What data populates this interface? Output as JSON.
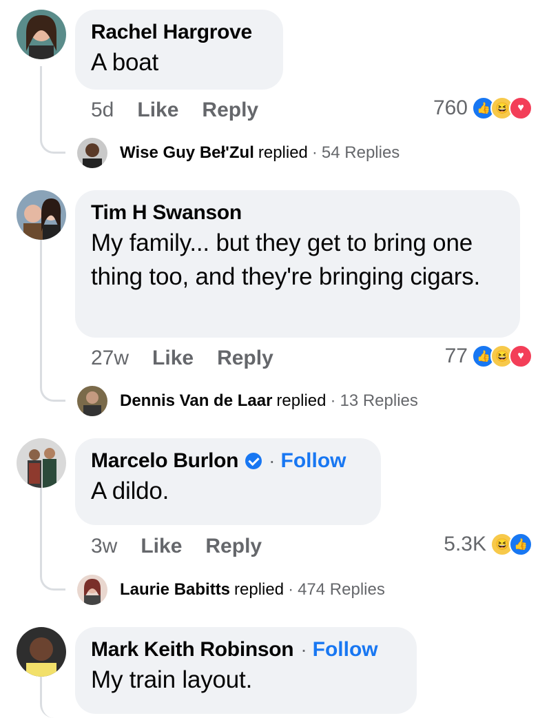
{
  "comments": [
    {
      "author": "Rachel Hargrove",
      "text": "A boat",
      "time": "5d",
      "like": "Like",
      "reply": "Reply",
      "reaction_count": "760",
      "reactions": [
        "like",
        "haha",
        "love"
      ],
      "reply_preview": {
        "name": "Wise Guy Beł'Zul",
        "action": "replied",
        "dot": "·",
        "count": "54 Replies"
      }
    },
    {
      "author": "Tim H Swanson",
      "text": "My family... but they get to bring one thing too, and they're bringing cigars.",
      "time": "27w",
      "like": "Like",
      "reply": "Reply",
      "reaction_count": "77",
      "reactions": [
        "like",
        "haha",
        "love"
      ],
      "reply_preview": {
        "name": "Dennis Van de Laar",
        "action": "replied",
        "dot": "·",
        "count": "13 Replies"
      }
    },
    {
      "author": "Marcelo Burlon",
      "verified": true,
      "dot": "·",
      "follow": "Follow",
      "text": "A dildo.",
      "time": "3w",
      "like": "Like",
      "reply": "Reply",
      "reaction_count": "5.3K",
      "reactions": [
        "haha",
        "like"
      ],
      "reply_preview": {
        "name": "Laurie Babitts",
        "action": "replied",
        "dot": "·",
        "count": "474 Replies"
      }
    },
    {
      "author": "Mark Keith Robinson",
      "dot": "·",
      "follow": "Follow",
      "text": "My train layout."
    }
  ],
  "colors": {
    "accent": "#1877f2",
    "bubble": "#f0f2f5",
    "muted": "#65676b",
    "love": "#f33e58",
    "haha": "#f7c94a"
  }
}
